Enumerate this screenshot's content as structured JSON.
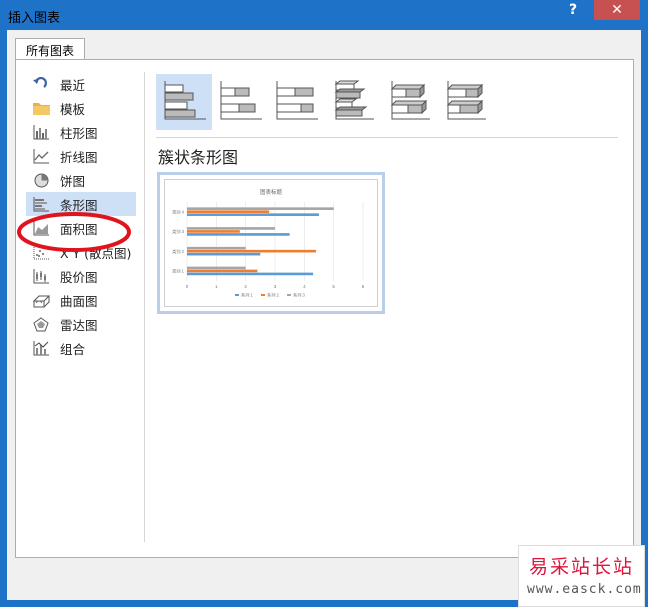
{
  "window": {
    "title": "插入图表",
    "help_label": "?",
    "close_label": "✕"
  },
  "tabs": [
    {
      "label": "所有图表"
    }
  ],
  "sidebar": {
    "items": [
      {
        "label": "最近",
        "icon": "recent-icon"
      },
      {
        "label": "模板",
        "icon": "folder-icon"
      },
      {
        "label": "柱形图",
        "icon": "column-chart-icon"
      },
      {
        "label": "折线图",
        "icon": "line-chart-icon"
      },
      {
        "label": "饼图",
        "icon": "pie-chart-icon"
      },
      {
        "label": "条形图",
        "icon": "bar-chart-icon",
        "selected": true
      },
      {
        "label": "面积图",
        "icon": "area-chart-icon"
      },
      {
        "label": "X Y (散点图)",
        "icon": "scatter-chart-icon"
      },
      {
        "label": "股价图",
        "icon": "stock-chart-icon"
      },
      {
        "label": "曲面图",
        "icon": "surface-chart-icon"
      },
      {
        "label": "雷达图",
        "icon": "radar-chart-icon"
      },
      {
        "label": "组合",
        "icon": "combo-chart-icon"
      }
    ]
  },
  "subtypes": {
    "selected_title": "簇状条形图",
    "items": [
      {
        "icon": "clustered-bar-icon",
        "selected": true
      },
      {
        "icon": "stacked-bar-icon"
      },
      {
        "icon": "percent-stacked-bar-icon"
      },
      {
        "icon": "3d-clustered-bar-icon"
      },
      {
        "icon": "3d-stacked-bar-icon"
      },
      {
        "icon": "3d-percent-stacked-bar-icon"
      }
    ]
  },
  "preview": {
    "chart_data": {
      "type": "bar",
      "title": "图表标题",
      "categories": [
        "类别 1",
        "类别 2",
        "类别 3",
        "类别 4"
      ],
      "series": [
        {
          "name": "系列 1",
          "values": [
            4.3,
            2.5,
            3.5,
            4.5
          ]
        },
        {
          "name": "系列 2",
          "values": [
            2.4,
            4.4,
            1.8,
            2.8
          ]
        },
        {
          "name": "系列 3",
          "values": [
            2,
            2,
            3,
            5
          ]
        }
      ],
      "xlim": [
        0,
        6
      ],
      "ticks": [
        "0",
        "1",
        "2",
        "3",
        "4",
        "5",
        "6"
      ],
      "grid": true,
      "legend": "bottom",
      "colors": [
        "#5b9bd5",
        "#ed7d31",
        "#a5a5a5"
      ]
    }
  },
  "watermark": {
    "text": "易采站长站",
    "url": "www.easck.com"
  },
  "annotation": {
    "color": "#e0141e"
  }
}
